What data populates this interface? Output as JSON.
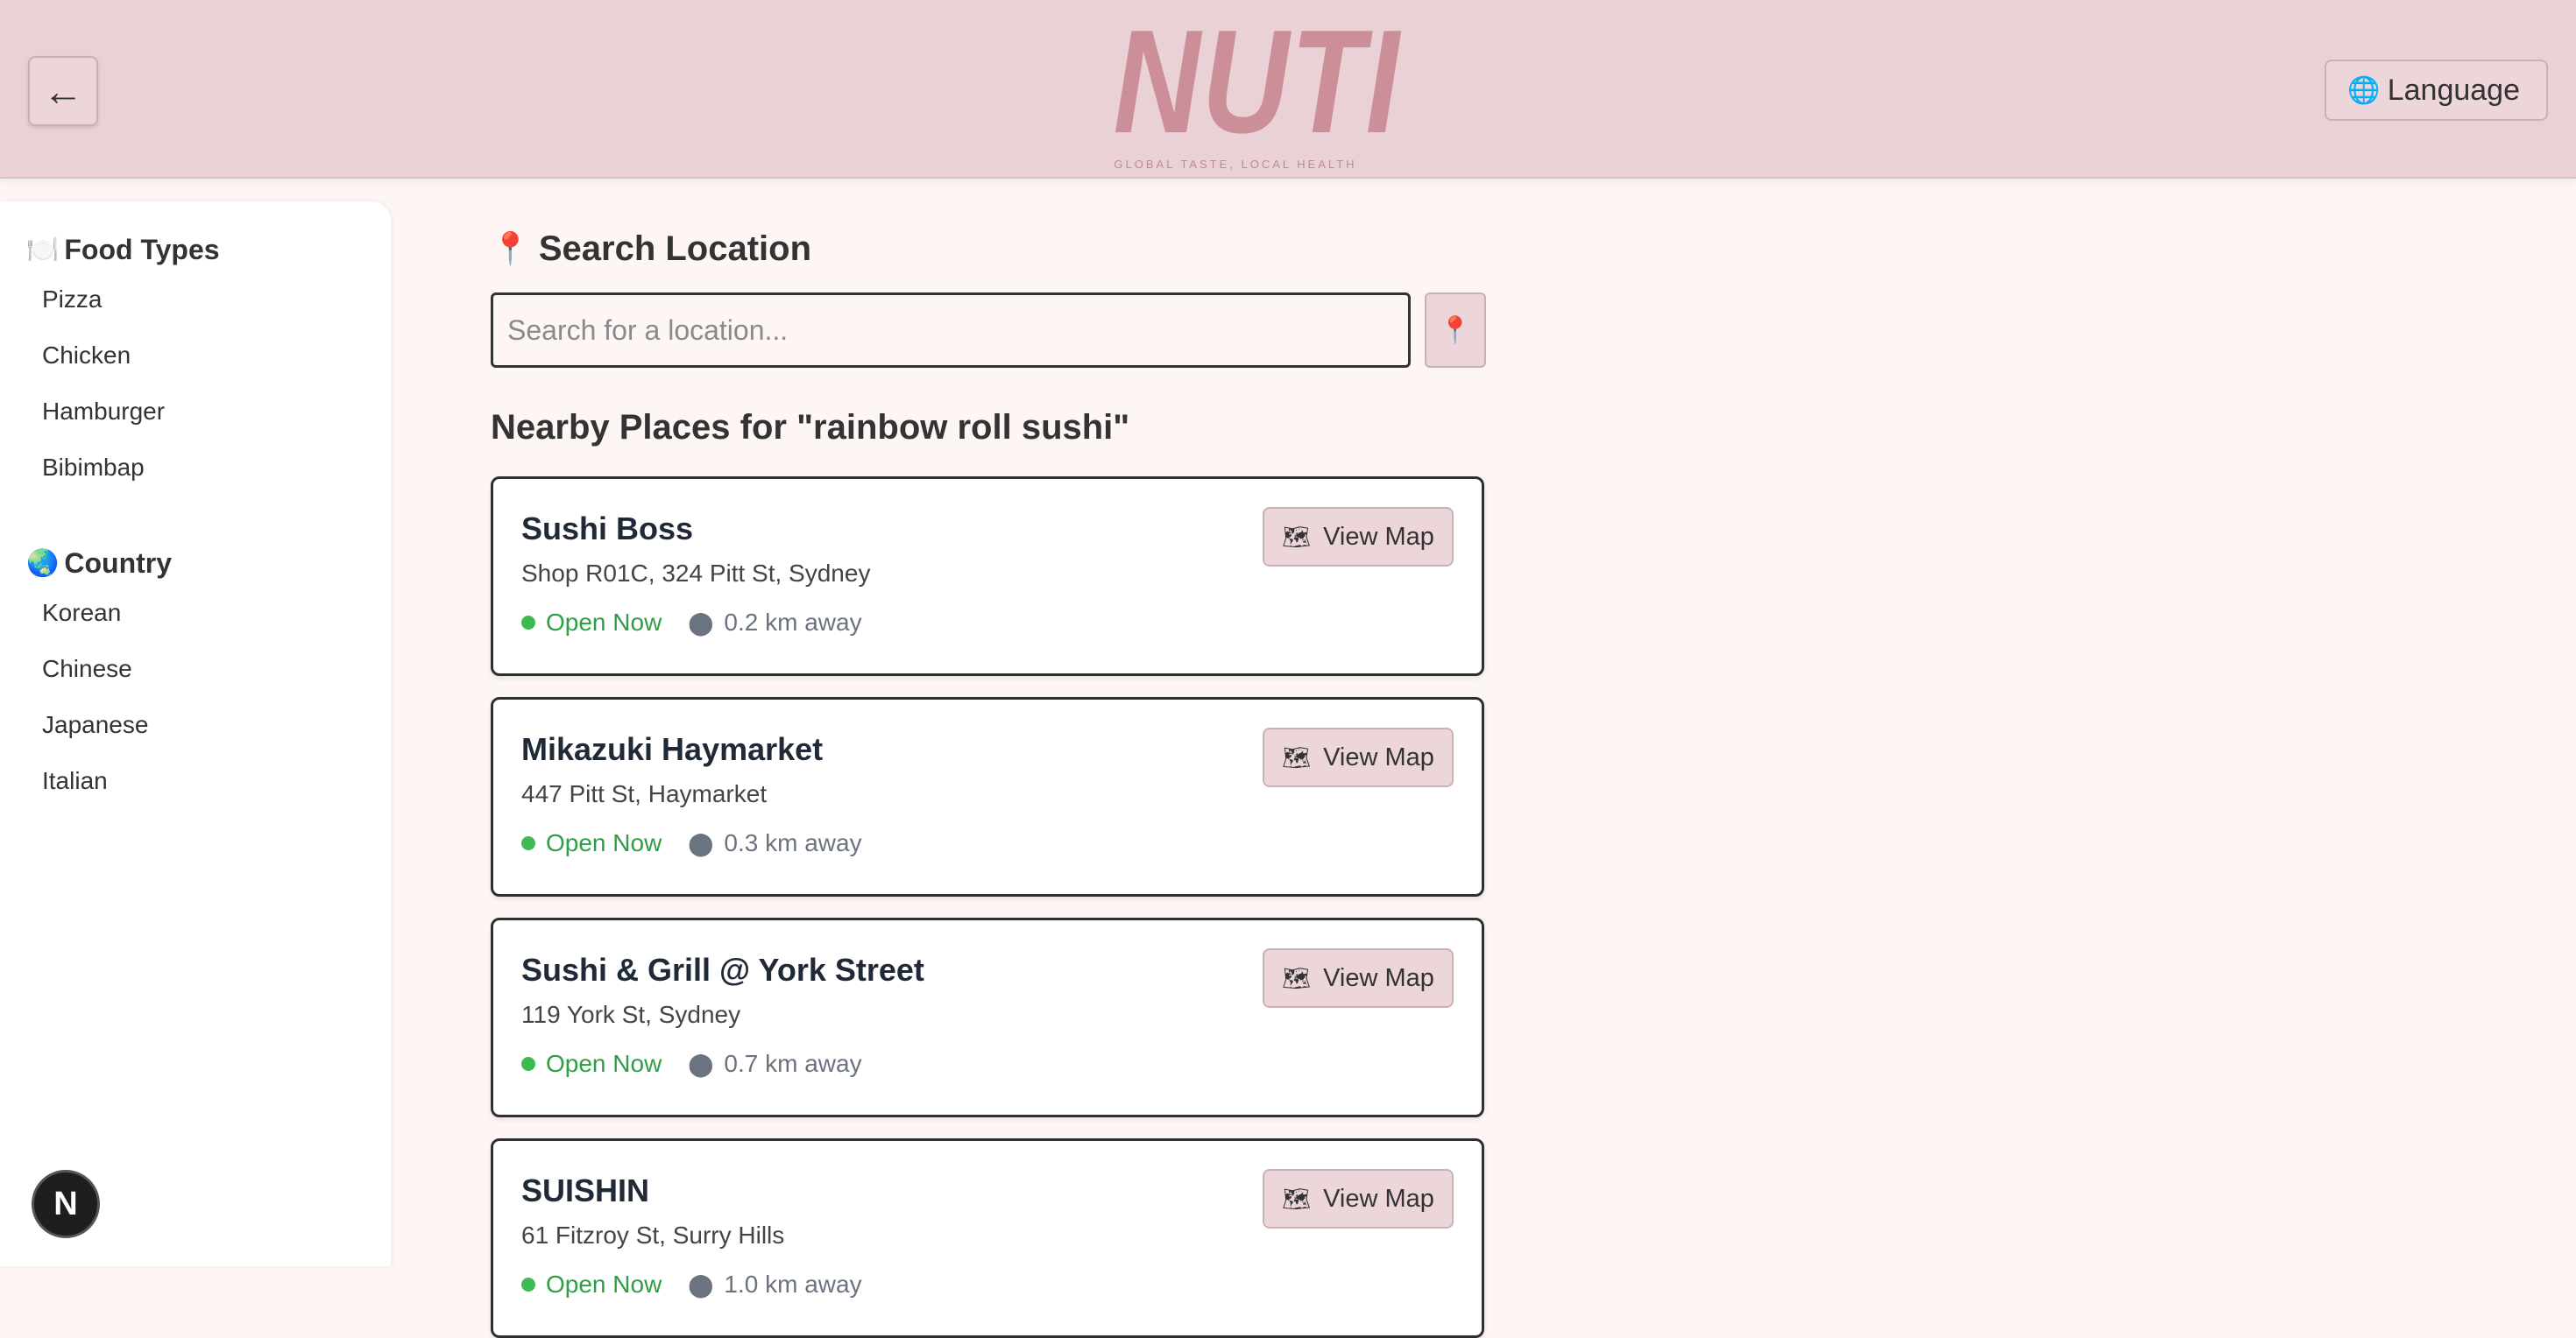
{
  "header": {
    "back_icon": "←",
    "logo_text": "NUTI",
    "tagline": "GLOBAL TASTE, LOCAL HEALTH",
    "language_icon": "🌐",
    "language_label": "Language"
  },
  "sidebar": {
    "food_types": {
      "icon": "🍽️",
      "title": "Food Types",
      "items": [
        "Pizza",
        "Chicken",
        "Hamburger",
        "Bibimbap"
      ]
    },
    "country": {
      "icon": "🌏",
      "title": "Country",
      "items": [
        "Korean",
        "Chinese",
        "Japanese",
        "Italian"
      ]
    },
    "badge": "N"
  },
  "search": {
    "icon": "📍",
    "title": "Search Location",
    "placeholder": "Search for a location...",
    "button_icon": "📍"
  },
  "results": {
    "title": "Nearby Places for \"rainbow roll sushi\"",
    "view_map_label": "View Map",
    "places": [
      {
        "name": "Sushi Boss",
        "address": "Shop R01C, 324 Pitt St, Sydney",
        "status": "Open Now",
        "distance": "0.2 km away"
      },
      {
        "name": "Mikazuki Haymarket",
        "address": "447 Pitt St, Haymarket",
        "status": "Open Now",
        "distance": "0.3 km away"
      },
      {
        "name": "Sushi & Grill @ York Street",
        "address": "119 York St, Sydney",
        "status": "Open Now",
        "distance": "0.7 km away"
      },
      {
        "name": "SUISHIN",
        "address": "61 Fitzroy St, Surry Hills",
        "status": "Open Now",
        "distance": "1.0 km away"
      }
    ]
  },
  "colors": {
    "header_bg": "#e9d1d5",
    "logo": "#cc8e98",
    "page_bg": "#fdf6f4",
    "open_green": "#2f9e47"
  }
}
